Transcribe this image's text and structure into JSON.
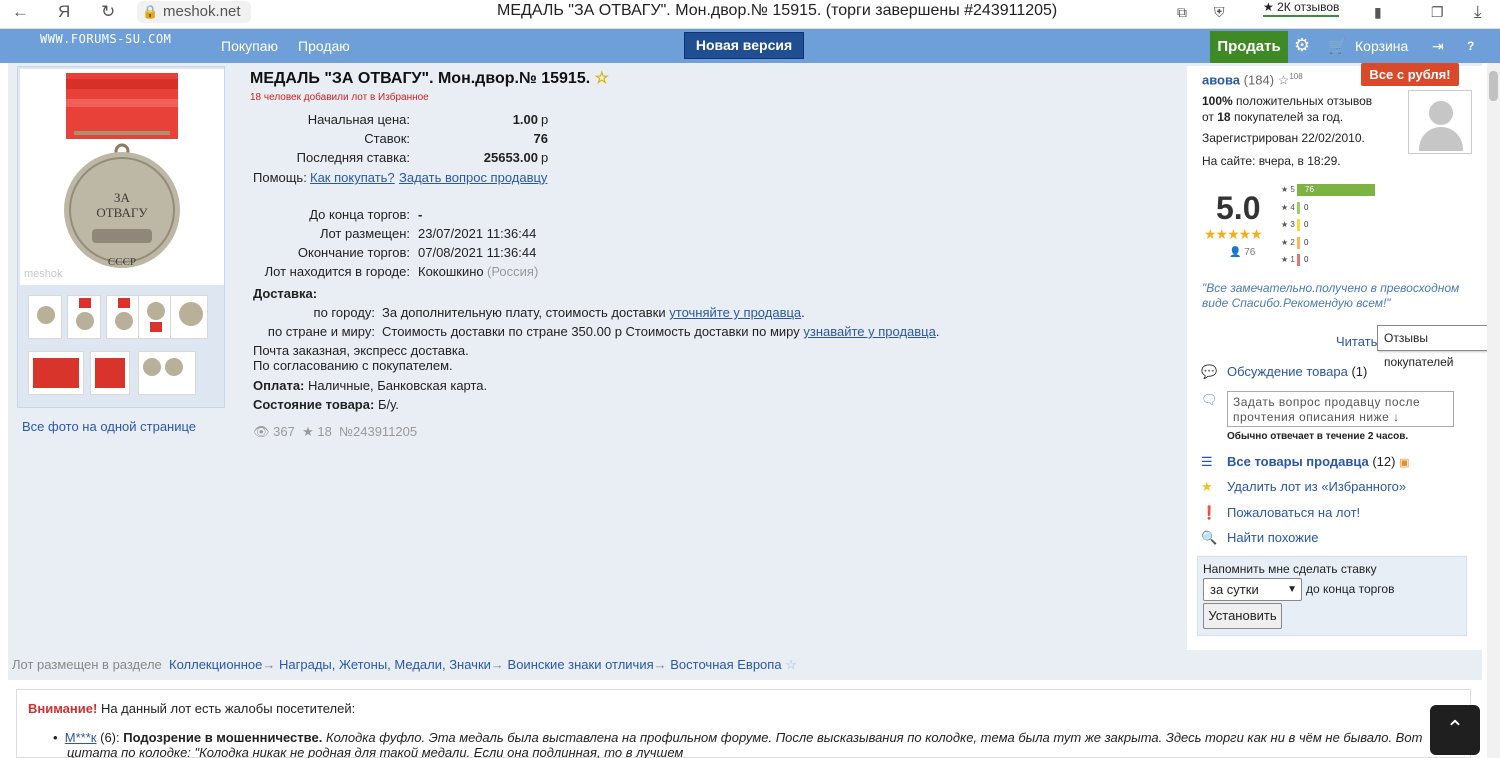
{
  "browser": {
    "url": "meshok.net",
    "tab_title": "МЕДАЛЬ \"ЗА ОТВАГУ\". Мон.двор.№ 15915. (торги завершены #243911205)",
    "reviews_label": "★ 2К отзывов"
  },
  "topbar": {
    "logo": "WWW.FORUMS-SU.COM",
    "buy": "Покупаю",
    "sell_nav": "Продаю",
    "new_version": "Новая версия",
    "sell_button": "Продать",
    "cart": "Корзина"
  },
  "lot": {
    "title": "МЕДАЛЬ \"ЗА ОТВАГУ\". Мон.двор.№ 15915.",
    "favorites_note": "18 человек добавили лот в Избранное",
    "start_price_label": "Начальная цена:",
    "start_price": "1.00",
    "currency": "р",
    "bids_label": "Ставок:",
    "bids": "76",
    "last_bid_label": "Последняя ставка:",
    "last_bid": "25653.00",
    "help_label": "Помощь:",
    "help_how": "Как покупать?",
    "help_ask": "Задать вопрос продавцу",
    "ends_label": "До конца торгов:",
    "ends": "-",
    "placed_label": "Лот размещен:",
    "placed": "23/07/2021 11:36:44",
    "end_label": "Окончание торгов:",
    "end": "07/08/2021 11:36:44",
    "city_label": "Лот находится в городе:",
    "city": "Кокошкино",
    "country": "(Россия)",
    "delivery_label": "Доставка:",
    "city_del_label": "по городу:",
    "city_del_text": "За дополнительную плату, стоимость доставки",
    "city_del_link": "уточняйте у продавца",
    "country_del_label": "по стране и миру:",
    "country_del_text": "Стоимость доставки по стране 350.00 р Стоимость доставки по миру",
    "country_del_link": "узнавайте у продавца",
    "post_note": "Почта заказная, экспресс доставка.",
    "agree_note": "По согласованию с покупателем.",
    "payment_label": "Оплата:",
    "payment": "Наличные, Банковская карта.",
    "condition_label": "Состояние товара:",
    "condition": "Б/у.",
    "views": "367",
    "stars": "18",
    "lot_no": "№243911205"
  },
  "photos": {
    "all_link": "Все фото на одной странице",
    "medal_top": "ЗА",
    "medal_mid": "ОТВАГУ",
    "medal_bottom": "СССР",
    "watermark": "meshok"
  },
  "seller": {
    "name": "авова",
    "count": "(184)",
    "star_num": "108",
    "badge": "Все с рубля!",
    "positive_pct": "100%",
    "positive_text": "положительных отзывов",
    "from": "от",
    "buyers_count": "18",
    "buyers_text": "покупателей за год.",
    "registered": "Зарегистрирован 22/02/2010.",
    "online": "На сайте: вчера, в 18:29.",
    "rating": "5.0",
    "rating_count": "76",
    "hist": [
      {
        "star": "5",
        "count": "76",
        "fraction": 1.0,
        "color": "#7cb342"
      },
      {
        "star": "4",
        "count": "0",
        "fraction": 0,
        "color": "#9ccc65"
      },
      {
        "star": "3",
        "count": "0",
        "fraction": 0,
        "color": "#fdd835"
      },
      {
        "star": "2",
        "count": "0",
        "fraction": 0,
        "color": "#ffb74d"
      },
      {
        "star": "1",
        "count": "0",
        "fraction": 0,
        "color": "#e57373"
      }
    ],
    "quote": "\"Все замечательно.получено в превосходном виде Спасибо.Рекомендую всем!\"",
    "read": "Читать",
    "tooltip": "Отзывы покупателей",
    "discussion": "Обсуждение товара",
    "discussion_count": "(1)",
    "ask_placeholder": "Задать вопрос продавцу после прочтения описания ниже ↓",
    "response_note": "Обычно отвечает в течение",
    "response_hours": "2",
    "response_unit": "часов.",
    "all_goods": "Все товары продавца",
    "all_goods_count": "(12)",
    "remove_fav": "Удалить лот из «Избранного»",
    "complain": "Пожаловаться на лот!",
    "similar": "Найти похожие",
    "remind_title": "Напомнить мне сделать ставку",
    "remind_select": "за сутки",
    "remind_suffix": "до конца торгов",
    "remind_button": "Установить"
  },
  "breadcrumb": {
    "prefix": "Лот размещен в разделе",
    "items": [
      "Коллекционное",
      "Награды, Жетоны, Медали, Значки",
      "Воинские знаки отличия",
      "Восточная Европа"
    ]
  },
  "complaints": {
    "attention": "Внимание!",
    "intro": "На данный лот есть жалобы посетителей:",
    "user": "М***к",
    "user_count": "(6):",
    "reason": "Подозрение в мошенничестве.",
    "text": "Колодка фуфло. Эта медаль была выставлена на профильном форуме. После высказывания по колодке, тема была тут же закрыта. Здесь торги как ни в чём не бывало. Вот",
    "text2": "цитата по колодке: \"Колодка никак не родная для такой медали. Если она подлинная, то в лучшем"
  }
}
